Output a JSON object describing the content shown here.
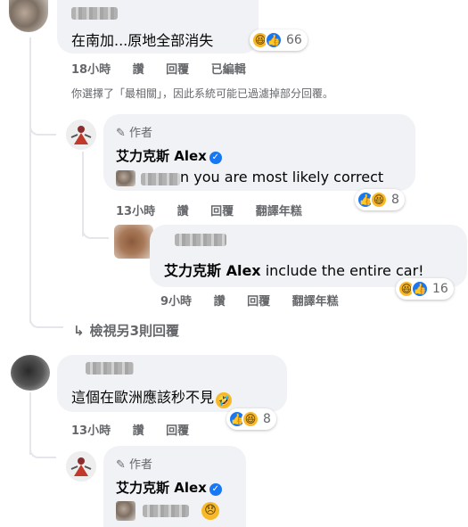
{
  "comment1": {
    "text": "在南加...原地全部消失",
    "reaction_count": "66",
    "time": "18小時",
    "like": "讚",
    "reply": "回覆",
    "edited": "已編輯",
    "icons": [
      "haha-reaction-icon",
      "like-reaction-icon"
    ]
  },
  "filter_notice": "你選擇了「最相關」，因此系統可能已過濾掉部分回覆。",
  "reply1": {
    "author_tag": "作者",
    "name": "艾力克斯 Alex",
    "text": "n you are most likely correct",
    "reaction_count": "8",
    "time": "13小時",
    "like": "讚",
    "reply": "回覆",
    "translate": "翻譯年糕"
  },
  "reply2": {
    "mention": "艾力克斯 Alex",
    "text": " include the entire car!",
    "reaction_count": "16",
    "time": "9小時",
    "like": "讚",
    "reply": "回覆",
    "translate": "翻譯年糕"
  },
  "view_more": "檢視另3則回覆",
  "comment2": {
    "text": "這個在歐洲應該秒不見",
    "reaction_count": "8",
    "time": "13小時",
    "like": "讚",
    "reply": "回覆"
  },
  "reply3": {
    "author_tag": "作者",
    "name": "艾力克斯 Alex"
  },
  "colors": {
    "bubble": "#f0f2f5",
    "like_blue": "#1877f2",
    "haha_yellow": "#f7b928",
    "meta_gray": "#65676b"
  }
}
